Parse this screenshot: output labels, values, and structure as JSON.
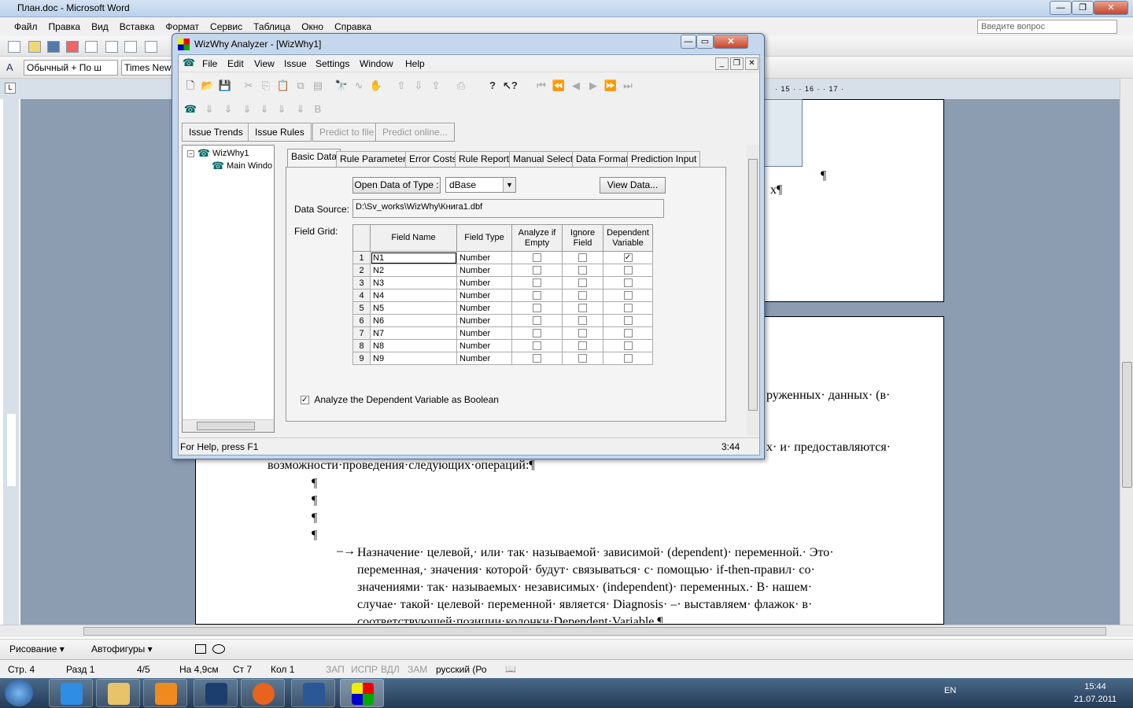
{
  "word": {
    "title": "План.doc - Microsoft Word",
    "menu": [
      "Файл",
      "Правка",
      "Вид",
      "Вставка",
      "Формат",
      "Сервис",
      "Таблица",
      "Окно",
      "Справка"
    ],
    "ask_placeholder": "Введите вопрос",
    "style_box": "Обычный + По ш",
    "font_box": "Times New",
    "ruler_numbers": "· 15 · · 16 · · 17 ·",
    "doc_fragments": {
      "x_pilcrow": "х¶",
      "pilcrow": "¶",
      "line_a": "руженных· данных· (в·",
      "line_b": "х· и· предоставляются·",
      "line_c": "возможности·проведения·следующих·операций:¶"
    },
    "bullet": "–→",
    "paragraph": [
      "Назначение· целевой,· или· так· называемой· зависимой· (dependent)· переменной.· Это·",
      "переменная,· значения· которой· будут· связываться· с· помощью· if-then-правил· со·",
      "значениями· так· называемых· независимых· (independent)· переменных.· В· нашем·",
      "случае· такой· целевой· переменной· является· Diagnosis· –· выставляем· флажок· в·",
      "соответствующей·позиции·колонки·Dependent·Variable.¶"
    ],
    "draw_bar": {
      "drawing": "Рисование ▾",
      "autoshapes": "Автофигуры ▾"
    },
    "status": {
      "page": "Стр. 4",
      "section": "Разд 1",
      "pages": "4/5",
      "at": "На 4,9см",
      "line": "Ст 7",
      "col": "Кол 1",
      "rec": "ЗАП",
      "trk": "ИСПР",
      "ext": "ВДЛ",
      "ovr": "ЗАМ",
      "lang": "русский (Ро"
    }
  },
  "wizwhy": {
    "title": "WizWhy Analyzer - [WizWhy1]",
    "menu": [
      "File",
      "Edit",
      "View",
      "Issue",
      "Settings",
      "Window",
      "Help"
    ],
    "mode_buttons": [
      "Issue Trends",
      "Issue Rules",
      "Predict to file",
      "Predict online..."
    ],
    "tree": {
      "root": "WizWhy1",
      "child": "Main Windo"
    },
    "tabs": [
      "Basic Data",
      "Rule Parameters",
      "Error Costs",
      "Rule Report",
      "Manual Select",
      "Data Format",
      "Prediction Input"
    ],
    "open_data_label": "Open Data of Type :",
    "data_type": "dBase",
    "view_data": "View Data...",
    "data_source_label": "Data Source:",
    "data_source": "D:\\Sv_works\\WizWhy\\Книга1.dbf",
    "field_grid_label": "Field Grid:",
    "grid_headers": [
      "Field Name",
      "Field Type",
      "Analyze if Empty",
      "Ignore Field",
      "Dependent Variable"
    ],
    "rows": [
      {
        "n": "1",
        "name": "N1",
        "type": "Number",
        "dep": true
      },
      {
        "n": "2",
        "name": "N2",
        "type": "Number",
        "dep": false
      },
      {
        "n": "3",
        "name": "N3",
        "type": "Number",
        "dep": false
      },
      {
        "n": "4",
        "name": "N4",
        "type": "Number",
        "dep": false
      },
      {
        "n": "5",
        "name": "N5",
        "type": "Number",
        "dep": false
      },
      {
        "n": "6",
        "name": "N6",
        "type": "Number",
        "dep": false
      },
      {
        "n": "7",
        "name": "N7",
        "type": "Number",
        "dep": false
      },
      {
        "n": "8",
        "name": "N8",
        "type": "Number",
        "dep": false
      },
      {
        "n": "9",
        "name": "N9",
        "type": "Number",
        "dep": false
      }
    ],
    "bool_label": "Analyze the Dependent Variable as Boolean",
    "bool_checked": true,
    "status_help": "For Help, press F1",
    "status_time": "3:44"
  },
  "taskbar": {
    "lang": "EN",
    "time": "15:44",
    "date": "21.07.2011"
  }
}
